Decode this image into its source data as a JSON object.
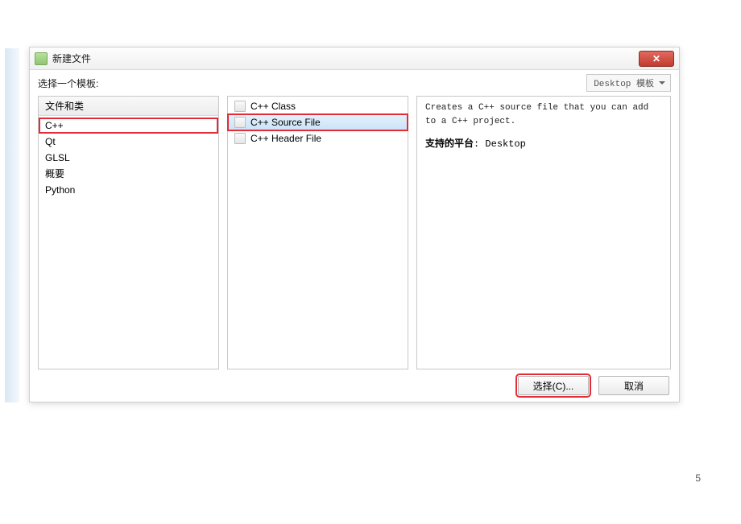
{
  "window": {
    "title": "新建文件",
    "close_glyph": "✕"
  },
  "topbar": {
    "label": "选择一个模板:",
    "template_select": "Desktop 模板"
  },
  "categories": {
    "header": "文件和类",
    "items": [
      {
        "label": "C++",
        "selected": true
      },
      {
        "label": "Qt",
        "selected": false
      },
      {
        "label": "GLSL",
        "selected": false
      },
      {
        "label": "概要",
        "selected": false
      },
      {
        "label": "Python",
        "selected": false
      }
    ]
  },
  "files": {
    "items": [
      {
        "label": "C++ Class",
        "selected": false
      },
      {
        "label": "C++ Source File",
        "selected": true
      },
      {
        "label": "C++ Header File",
        "selected": false
      }
    ]
  },
  "description": {
    "text": "Creates a C++ source file that you can add to a C++ project.",
    "platform_label": "支持的平台",
    "platform_value": ": Desktop"
  },
  "footer": {
    "choose": "选择(C)...",
    "cancel": "取消"
  },
  "page_number": "5"
}
